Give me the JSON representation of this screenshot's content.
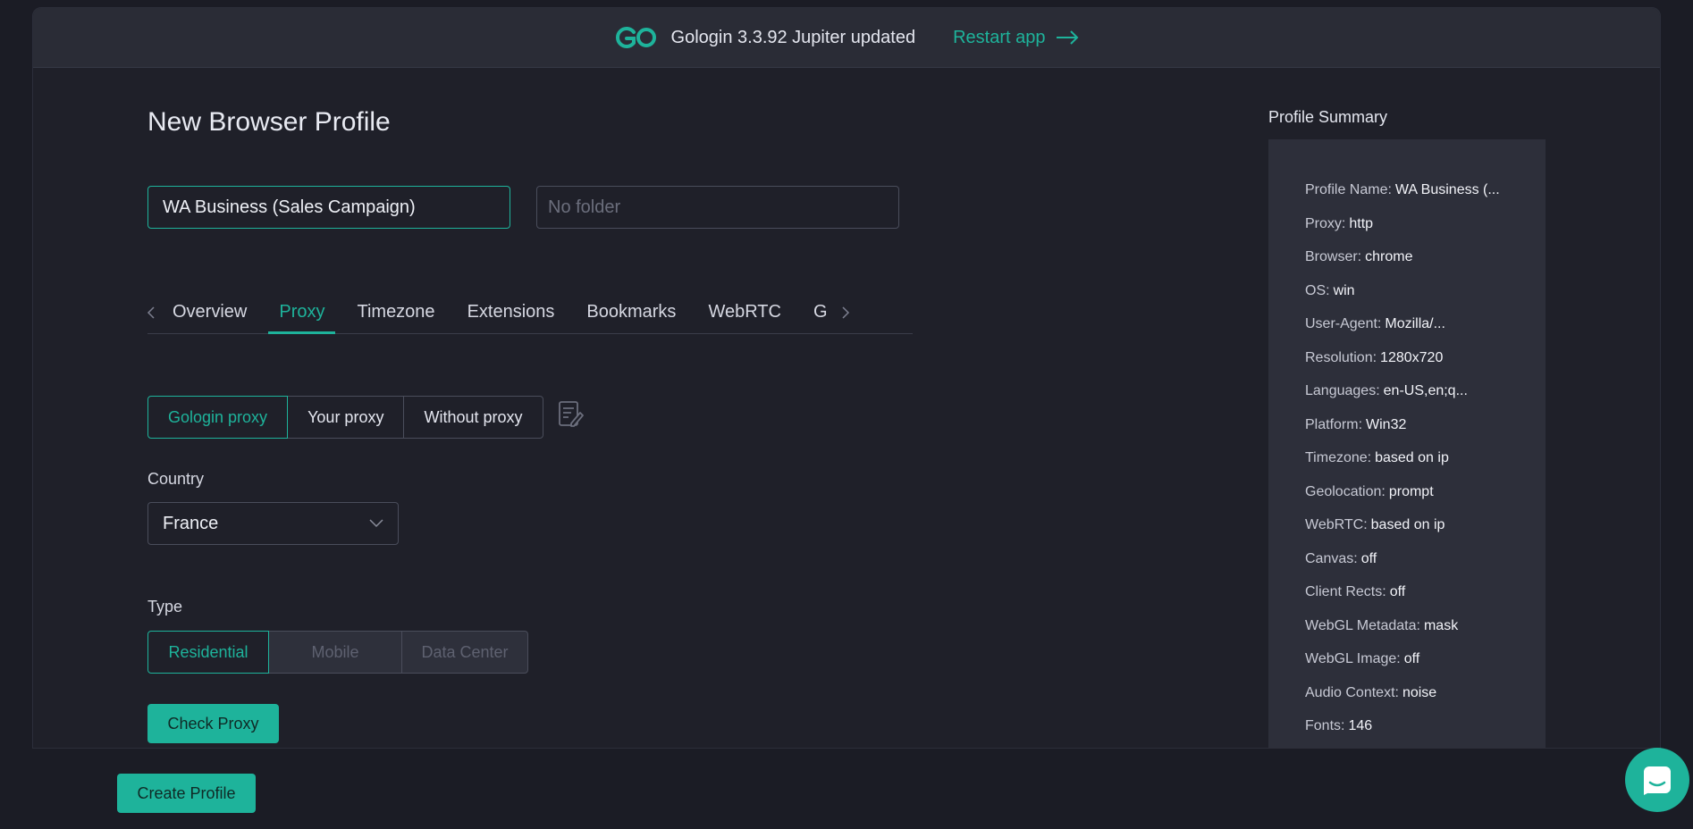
{
  "banner": {
    "text": "Gologin 3.3.92 Jupiter updated",
    "restart_label": "Restart app"
  },
  "page": {
    "title": "New Browser Profile"
  },
  "form": {
    "profile_name_value": "WA Business (Sales Campaign)",
    "folder_placeholder": "No folder"
  },
  "tabs": [
    {
      "label": "Overview",
      "active": false
    },
    {
      "label": "Proxy",
      "active": true
    },
    {
      "label": "Timezone",
      "active": false
    },
    {
      "label": "Extensions",
      "active": false
    },
    {
      "label": "Bookmarks",
      "active": false
    },
    {
      "label": "WebRTC",
      "active": false
    },
    {
      "label": "G",
      "active": false
    }
  ],
  "proxy": {
    "modes": [
      {
        "label": "Gologin proxy",
        "active": true
      },
      {
        "label": "Your proxy",
        "active": false
      },
      {
        "label": "Without proxy",
        "active": false
      }
    ],
    "country_label": "Country",
    "country_value": "France",
    "type_label": "Type",
    "types": [
      {
        "label": "Residential",
        "active": true
      },
      {
        "label": "Mobile",
        "active": false
      },
      {
        "label": "Data Center",
        "active": false
      }
    ],
    "check_label": "Check Proxy"
  },
  "summary": {
    "title": "Profile Summary",
    "rows": [
      {
        "key": "Profile Name:",
        "value": "WA Business (..."
      },
      {
        "key": "Proxy:",
        "value": "http"
      },
      {
        "key": "Browser:",
        "value": "chrome"
      },
      {
        "key": "OS:",
        "value": "win"
      },
      {
        "key": "User-Agent:",
        "value": "Mozilla/..."
      },
      {
        "key": "Resolution:",
        "value": "1280x720"
      },
      {
        "key": "Languages:",
        "value": "en-US,en;q..."
      },
      {
        "key": "Platform:",
        "value": "Win32"
      },
      {
        "key": "Timezone:",
        "value": "based on ip"
      },
      {
        "key": "Geolocation:",
        "value": "prompt"
      },
      {
        "key": "WebRTC:",
        "value": "based on ip"
      },
      {
        "key": "Canvas:",
        "value": "off"
      },
      {
        "key": "Client Rects:",
        "value": "off"
      },
      {
        "key": "WebGL Metadata:",
        "value": "mask"
      },
      {
        "key": "WebGL Image:",
        "value": "off"
      },
      {
        "key": "Audio Context:",
        "value": "noise"
      },
      {
        "key": "Fonts:",
        "value": "146"
      }
    ]
  },
  "footer": {
    "create_label": "Create Profile"
  },
  "colors": {
    "accent": "#1eb39b",
    "background": "#1f2029",
    "panel": "#2d2f3a"
  },
  "icons": [
    "gologin-logo-icon",
    "arrow-right-icon",
    "chevron-left-icon",
    "chevron-right-icon",
    "notes-icon",
    "chevron-down-icon",
    "chat-icon"
  ]
}
